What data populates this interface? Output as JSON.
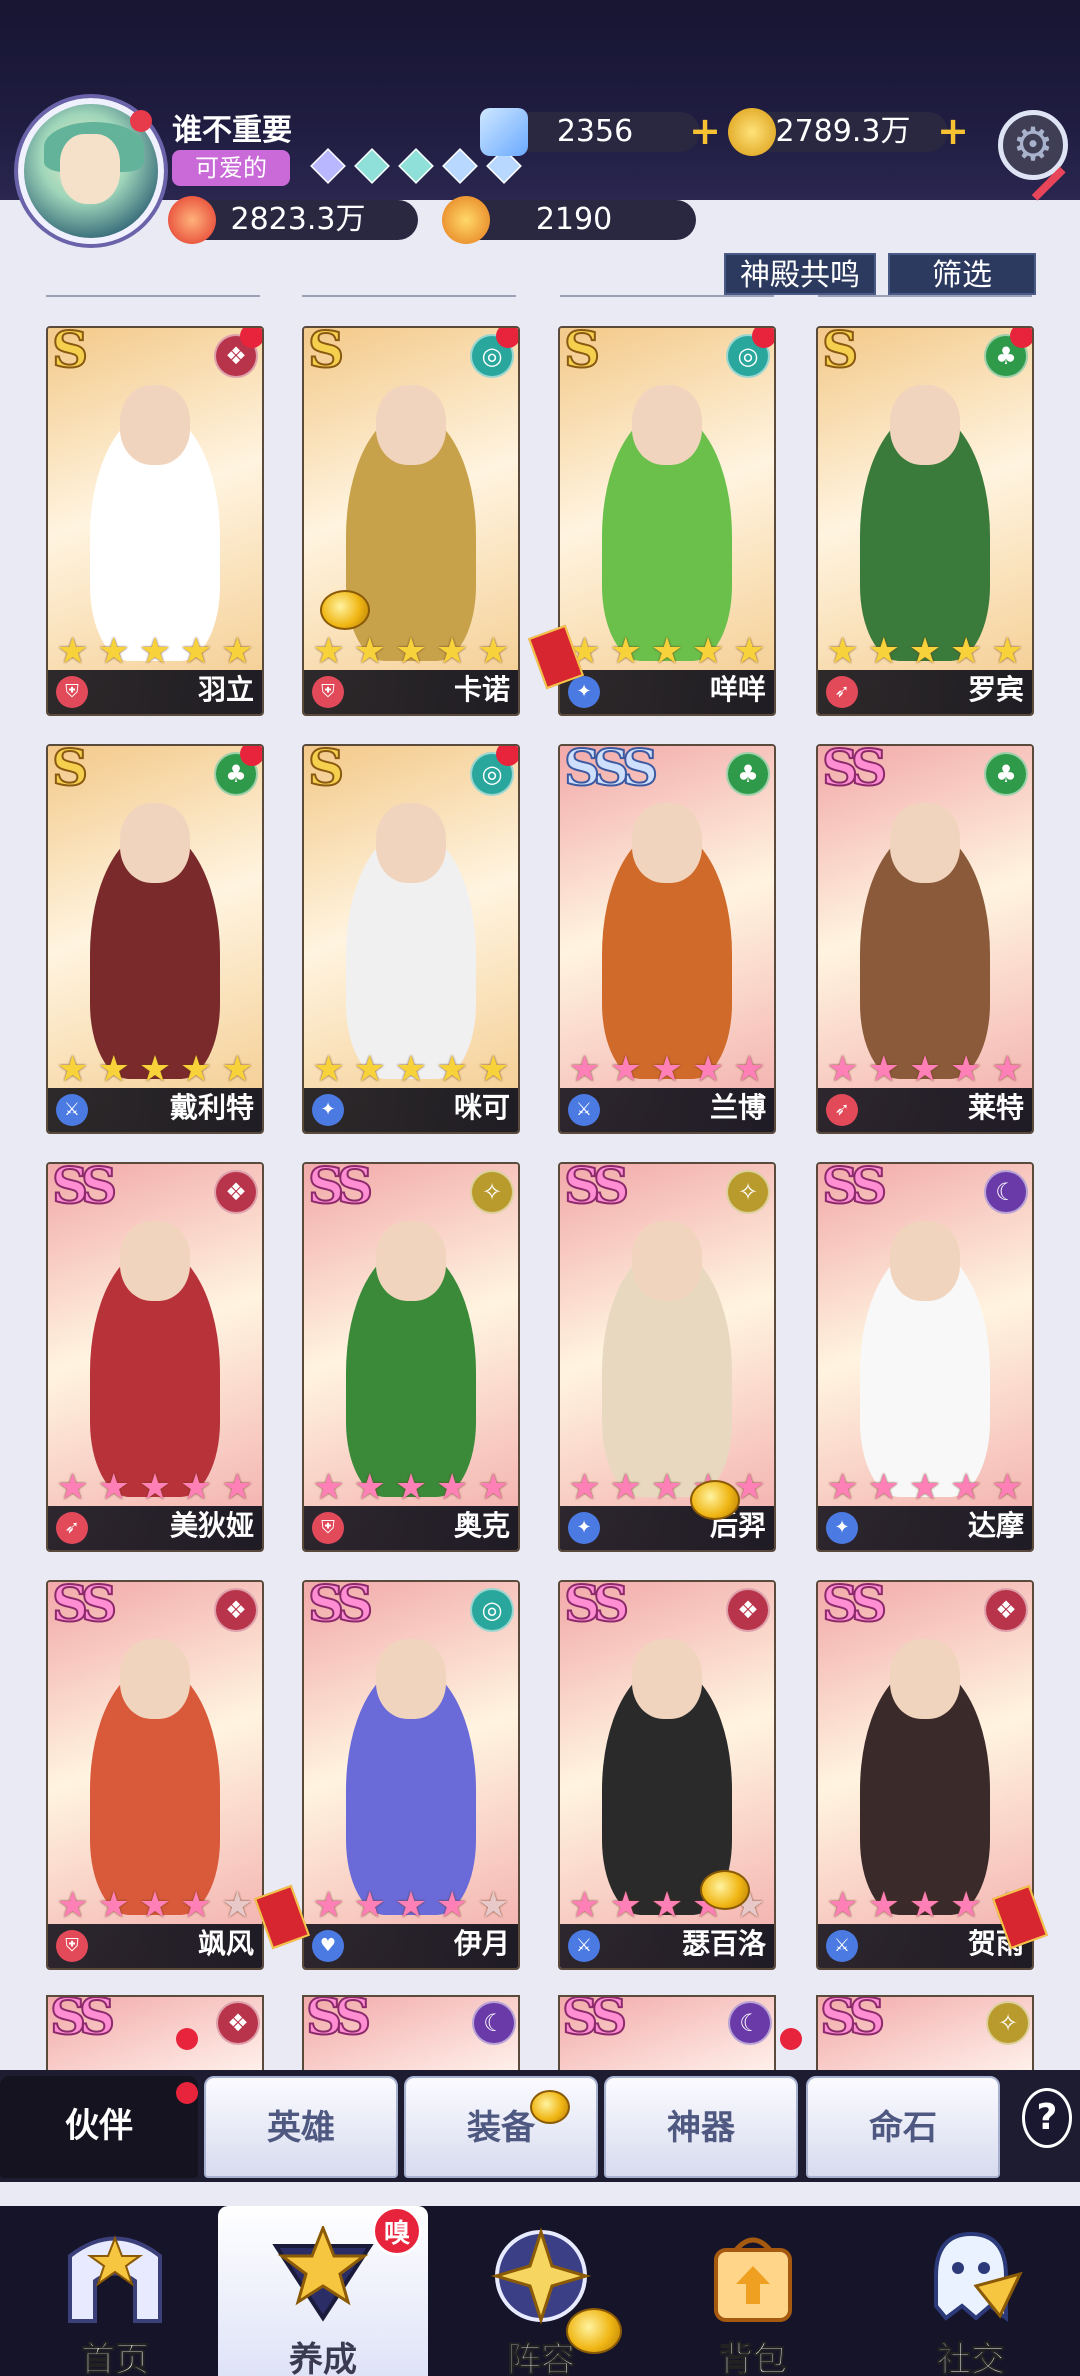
{
  "player": {
    "name": "谁不重要",
    "title_tag": "可爱的",
    "power": "2823.3万",
    "medals": "2190",
    "gem_count": 5
  },
  "currency": {
    "diamonds": "2356",
    "gold": "2789.3万"
  },
  "top_buttons": {
    "resonance": "神殿共鸣",
    "filter": "筛选"
  },
  "colors": {
    "gold_rank": "#f5d04e",
    "pink_rank": "#ff8ed3",
    "silver_rank": "#cfe0ff",
    "card_gold_bg": "#f3c989",
    "card_pink_bg": "#f2a9a9",
    "active_tab": "#15131f"
  },
  "heroes": [
    {
      "name": "羽立",
      "rank": "S",
      "stars": 5,
      "element": "fire",
      "class": "shield",
      "has_new": true
    },
    {
      "name": "卡诺",
      "rank": "S",
      "stars": 5,
      "element": "water",
      "class": "shield",
      "has_new": true
    },
    {
      "name": "咩咩",
      "rank": "S",
      "stars": 5,
      "element": "water",
      "class": "mage",
      "has_new": true
    },
    {
      "name": "罗宾",
      "rank": "S",
      "stars": 5,
      "element": "nature",
      "class": "archer",
      "has_new": true
    },
    {
      "name": "戴利特",
      "rank": "S",
      "stars": 5,
      "element": "nature",
      "class": "warrior",
      "has_new": true
    },
    {
      "name": "咪可",
      "rank": "S",
      "stars": 5,
      "element": "water",
      "class": "mage",
      "has_new": true
    },
    {
      "name": "兰博",
      "rank": "SSS",
      "stars": 5,
      "element": "nature",
      "class": "warrior",
      "has_new": false
    },
    {
      "name": "莱特",
      "rank": "SS",
      "stars": 5,
      "element": "nature",
      "class": "archer",
      "has_new": false
    },
    {
      "name": "美狄娅",
      "rank": "SS",
      "stars": 5,
      "element": "fire",
      "class": "archer",
      "has_new": false
    },
    {
      "name": "奥克",
      "rank": "SS",
      "stars": 5,
      "element": "light",
      "class": "shield",
      "has_new": false
    },
    {
      "name": "后羿",
      "rank": "SS",
      "stars": 5,
      "element": "light",
      "class": "mage",
      "has_new": false
    },
    {
      "name": "达摩",
      "rank": "SS",
      "stars": 5,
      "element": "dark",
      "class": "mage",
      "has_new": false
    },
    {
      "name": "飒风",
      "rank": "SS",
      "stars": 4,
      "element": "fire",
      "class": "shield",
      "has_new": false
    },
    {
      "name": "伊月",
      "rank": "SS",
      "stars": 4,
      "element": "water",
      "class": "heart",
      "has_new": false
    },
    {
      "name": "瑟百洛",
      "rank": "SS",
      "stars": 4,
      "element": "fire",
      "class": "warrior",
      "has_new": false
    },
    {
      "name": "贺雨",
      "rank": "SS",
      "stars": 4,
      "element": "fire",
      "class": "warrior",
      "has_new": false
    }
  ],
  "peek_cards": [
    {
      "rank": "SS",
      "element": "fire"
    },
    {
      "rank": "SS",
      "element": "dark"
    },
    {
      "rank": "SS",
      "element": "dark"
    },
    {
      "rank": "SS",
      "element": "light"
    }
  ],
  "tabs": [
    {
      "label": "伙伴",
      "active": true,
      "dot": true
    },
    {
      "label": "英雄",
      "active": false,
      "dot": false
    },
    {
      "label": "装备",
      "active": false,
      "dot": false
    },
    {
      "label": "神器",
      "active": false,
      "dot": true
    },
    {
      "label": "命石",
      "active": false,
      "dot": false
    }
  ],
  "help_label": "?",
  "nav": [
    {
      "label": "首页",
      "icon": "castle-icon",
      "active": false
    },
    {
      "label": "养成",
      "icon": "star-triangle-icon",
      "active": true
    },
    {
      "label": "阵容",
      "icon": "compass-star-icon",
      "active": false
    },
    {
      "label": "背包",
      "icon": "bag-icon",
      "active": false
    },
    {
      "label": "社交",
      "icon": "chat-ghost-icon",
      "active": false
    }
  ],
  "nav_badge": "嗅"
}
